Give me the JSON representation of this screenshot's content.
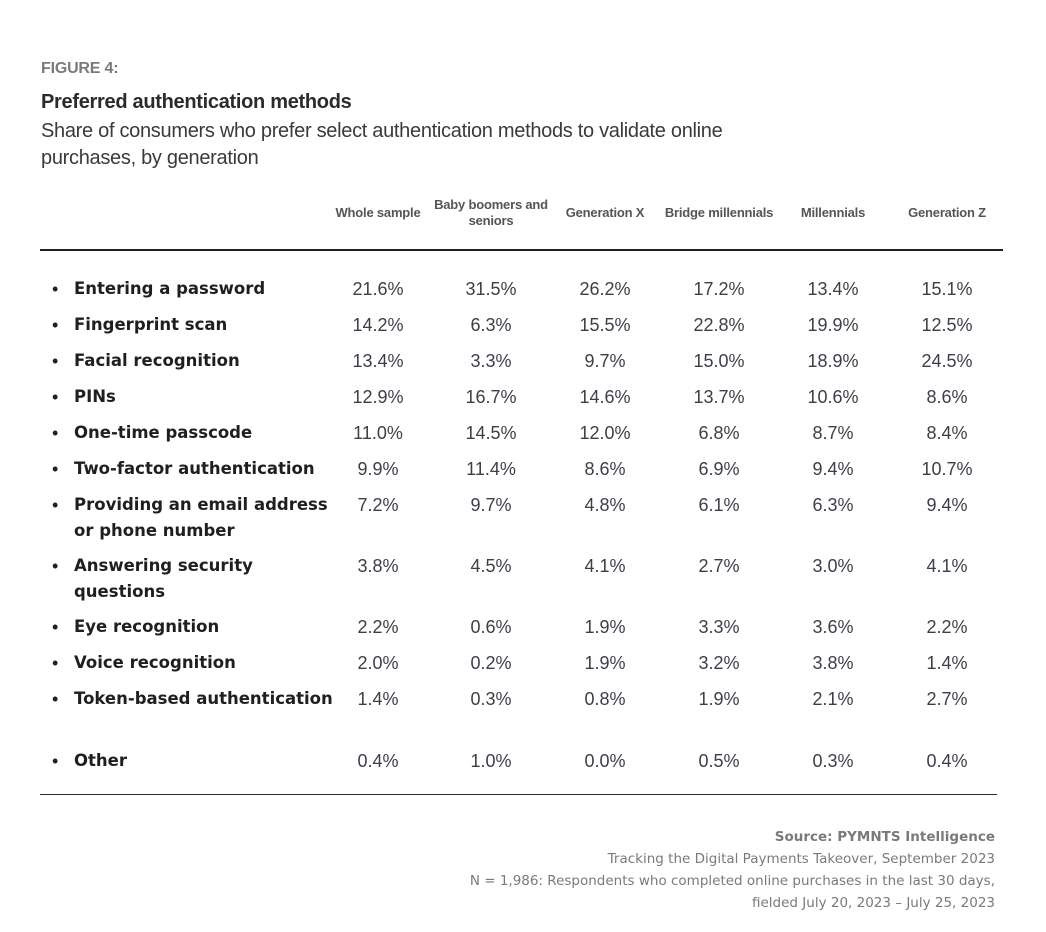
{
  "figure_label": "FIGURE 4:",
  "title": "Preferred authentication methods",
  "subtitle": "Share of consumers who prefer select authentication methods to validate online purchases, by generation",
  "chart_data": {
    "type": "table",
    "title": "Preferred authentication methods",
    "subtitle": "Share of consumers who prefer select authentication methods to validate online purchases, by generation",
    "columns": [
      "Whole sample",
      "Baby boomers and seniors",
      "Generation X",
      "Bridge millennials",
      "Millennials",
      "Generation Z"
    ],
    "rows": [
      {
        "label": "Entering a password",
        "values": [
          "21.6%",
          "31.5%",
          "26.2%",
          "17.2%",
          "13.4%",
          "15.1%"
        ]
      },
      {
        "label": "Fingerprint scan",
        "values": [
          "14.2%",
          "6.3%",
          "15.5%",
          "22.8%",
          "19.9%",
          "12.5%"
        ]
      },
      {
        "label": "Facial recognition",
        "values": [
          "13.4%",
          "3.3%",
          "9.7%",
          "15.0%",
          "18.9%",
          "24.5%"
        ]
      },
      {
        "label": "PINs",
        "values": [
          "12.9%",
          "16.7%",
          "14.6%",
          "13.7%",
          "10.6%",
          "8.6%"
        ]
      },
      {
        "label": "One-time passcode",
        "values": [
          "11.0%",
          "14.5%",
          "12.0%",
          "6.8%",
          "8.7%",
          "8.4%"
        ]
      },
      {
        "label": "Two-factor authentication",
        "values": [
          "9.9%",
          "11.4%",
          "8.6%",
          "6.9%",
          "9.4%",
          "10.7%"
        ]
      },
      {
        "label": "Providing an email address or phone number",
        "values": [
          "7.2%",
          "9.7%",
          "4.8%",
          "6.1%",
          "6.3%",
          "9.4%"
        ]
      },
      {
        "label": "Answering security questions",
        "values": [
          "3.8%",
          "4.5%",
          "4.1%",
          "2.7%",
          "3.0%",
          "4.1%"
        ]
      },
      {
        "label": "Eye recognition",
        "values": [
          "2.2%",
          "0.6%",
          "1.9%",
          "3.3%",
          "3.6%",
          "2.2%"
        ]
      },
      {
        "label": "Voice recognition",
        "values": [
          "2.0%",
          "0.2%",
          "1.9%",
          "3.2%",
          "3.8%",
          "1.4%"
        ]
      },
      {
        "label": "Token-based authentication",
        "values": [
          "1.4%",
          "0.3%",
          "0.8%",
          "1.9%",
          "2.1%",
          "2.7%"
        ]
      },
      {
        "label": "Other",
        "values": [
          "0.4%",
          "1.0%",
          "0.0%",
          "0.5%",
          "0.3%",
          "0.4%"
        ]
      }
    ]
  },
  "footer": {
    "source": "Source: PYMNTS Intelligence",
    "report": "Tracking the Digital Payments Takeover, September 2023",
    "sample": "N = 1,986: Respondents who completed online purchases in the last 30 days,",
    "fielded": "fielded July 20, 2023 – July 25, 2023"
  },
  "colors": {
    "figure_label": "#7a7a7a",
    "title": "#2b2b2b",
    "row_label": "#1f1f1f",
    "cell_value": "#3b3f48",
    "footer": "#7a7a7a",
    "rule": "#1e1e1e"
  }
}
